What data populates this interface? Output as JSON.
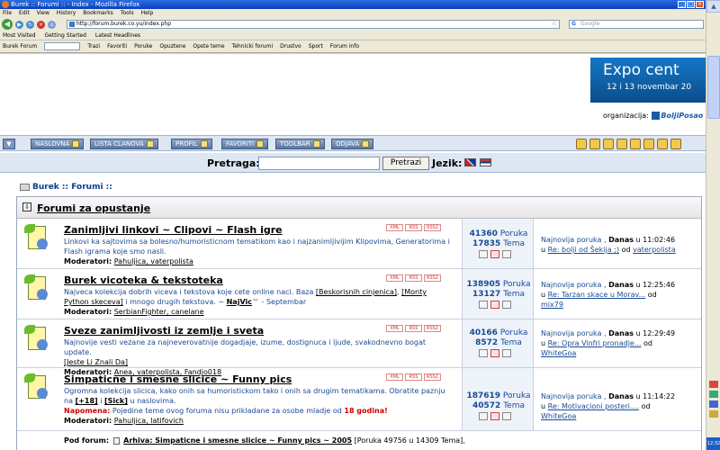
{
  "browser": {
    "title": "Burek :: Forumi :: - Index - Mozilla Firefox",
    "menu": [
      "File",
      "Edit",
      "View",
      "History",
      "Bookmarks",
      "Tools",
      "Help"
    ],
    "url": "http://forum.burek.co.yu/index.php",
    "search_placeholder": "Google",
    "bookmarks": [
      "Most Visited",
      "Getting Started",
      "Latest Headlines"
    ],
    "toolbar": [
      "Burek Forum",
      "Trazi",
      "Favoriti",
      "Poruke",
      "Opuztene",
      "Opste teme",
      "Tehnicki forumi",
      "Drustvo",
      "Sport",
      "Forum info"
    ]
  },
  "banner": {
    "title": "Expo cent",
    "dates": "12 i 13 novembar 20",
    "org_label": "organizacija:",
    "org_name": "BoljiPosao"
  },
  "nav": {
    "buttons": [
      "NASLOVNA",
      "LISTA CLANOVA",
      "PROFIL",
      "FAVORITI",
      "TOOLBAR",
      "ODJAVA"
    ]
  },
  "search": {
    "label": "Pretraga:",
    "button": "Pretrazi",
    "lang_label": "Jezik:"
  },
  "breadcrumb": "Burek :: Forumi ::",
  "category": "Forumi za opustanje",
  "rss_labels": [
    "XML",
    "RSS",
    "RSS2"
  ],
  "forums": [
    {
      "title": "Zanimljivi linkovi ~ Clipovi ~ Flash igre",
      "desc": "Linkovi ka sajtovima sa bolesno/humoristicnom tematikom kao i najzanimljivijim Klipovima, Generatorima i Flash igrama koje smo nasli.",
      "mods_label": "Moderatori:",
      "mods": "Pahuljica, vaterpolista",
      "posts": "41360",
      "posts_label": "Poruka",
      "topics": "17835",
      "topics_label": "Tema",
      "last_label": "Najnovija poruka",
      "last_day": "Danas",
      "last_time": "u 11:02:46",
      "last_u": "u",
      "last_title": "Re: bolji od Šekija ;)",
      "last_by": "od",
      "last_user": "vaterpolista"
    },
    {
      "title": "Burek vicoteka & tekstoteka",
      "desc_a": "Najveca kolekcija dobrih viceva i tekstova koje cete online naci. Baza",
      "desc_link1": "[Beskorisnih cinjenica]",
      "desc_link2": "[Monty Python skeceva]",
      "desc_b": "i mnogo drugih tekstova. ~",
      "desc_link3": "NajVic",
      "desc_c": "- Septembar",
      "mods_label": "Moderatori:",
      "mods": "SerbianFighter, canelane",
      "posts": "138905",
      "posts_label": "Poruka",
      "topics": "13127",
      "topics_label": "Tema",
      "last_label": "Najnovija poruka",
      "last_day": "Danas",
      "last_time": "u 12:25:46",
      "last_u": "u",
      "last_title": "Re: Tarzan skace u Morav...",
      "last_by": "od",
      "last_user": "mix79"
    },
    {
      "title": "Sveze zanimljivosti iz zemlje i sveta",
      "desc": "Najnovije vesti vezane za najneverovatnije dogadjaje, izume, dostignuca i ljude, svakodnevno bogat update.",
      "desc_link": "[Jeste Li Znali Da]",
      "mods_label": "Moderatori:",
      "mods": "Anea, vaterpolista, Fandjo018",
      "posts": "40166",
      "posts_label": "Poruka",
      "topics": "8572",
      "topics_label": "Tema",
      "last_label": "Najnovija poruka",
      "last_day": "Danas",
      "last_time": "u 12:29:49",
      "last_u": "u",
      "last_title": "Re: Opra Vinfri pronadje...",
      "last_by": "od",
      "last_user": "WhiteGoa"
    },
    {
      "title": "Simpaticne i smesne slicice ~ Funny pics",
      "desc_a": "Ogromna kolekcija slicica, kako onih sa humoristickom tako i onih sa drugim tematikama. Obratite paznju na",
      "desc_link1": "[+18]",
      "desc_b": "i",
      "desc_link2": "[Sick]",
      "desc_c": "u naslovima.",
      "warn_label": "Napomena:",
      "warn_text": "Pojedine teme ovog foruma nisu prikladane za osobe mladje od",
      "warn_age": "18 godina!",
      "mods_label": "Moderatori:",
      "mods": "Pahuljica, latifovich",
      "posts": "187619",
      "posts_label": "Poruka",
      "topics": "40572",
      "topics_label": "Tema",
      "last_label": "Najnovija poruka",
      "last_day": "Danas",
      "last_time": "u 11:14:22",
      "last_u": "u",
      "last_title": "Re: Motivacioni posteri....",
      "last_by": "od",
      "last_user": "WhiteGoa"
    }
  ],
  "subforum": {
    "label": "Pod forum:",
    "title": "Arhiva: Simpaticne i smesne slicice ~ Funny pics ~ 2005",
    "stats": "[Poruka 49756 u 14309 Tema],"
  },
  "clock": "12:32"
}
